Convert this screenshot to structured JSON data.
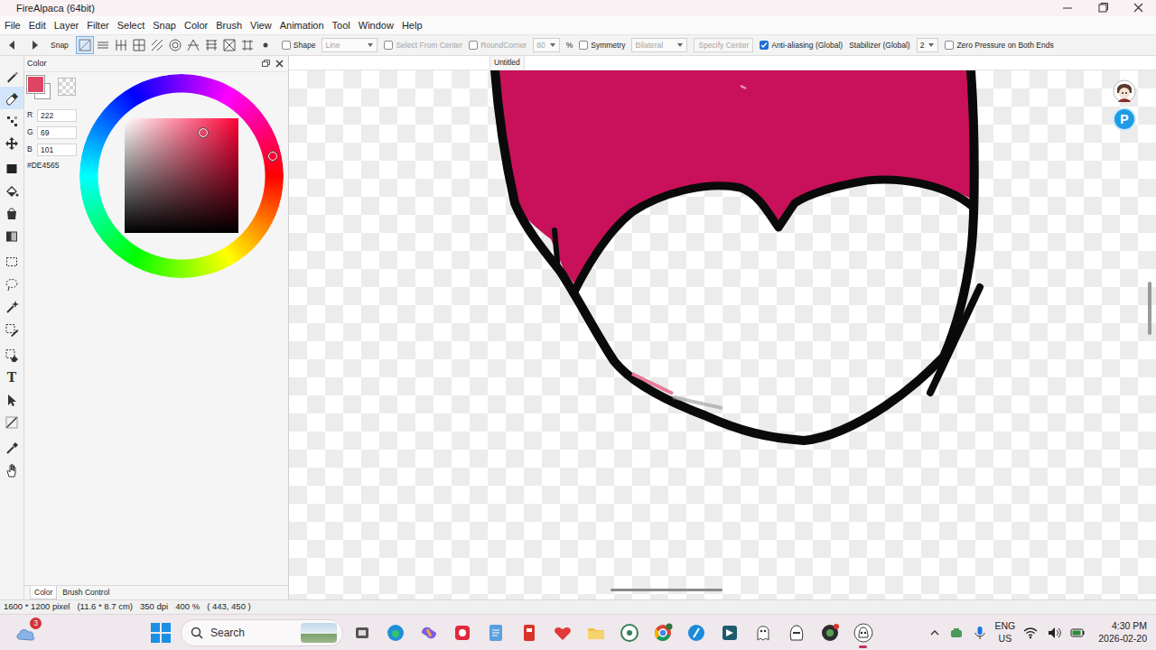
{
  "window": {
    "title": "FireAlpaca (64bit)"
  },
  "menu": [
    "File",
    "Edit",
    "Layer",
    "Filter",
    "Select",
    "Snap",
    "Color",
    "Brush",
    "View",
    "Animation",
    "Tool",
    "Window",
    "Help"
  ],
  "toolbar": {
    "snap_label": "Snap",
    "snap_modes": [
      {
        "selected": true
      },
      {
        "selected": false
      },
      {
        "selected": false
      },
      {
        "selected": false
      },
      {
        "selected": false
      },
      {
        "selected": false
      },
      {
        "selected": false
      },
      {
        "selected": false
      },
      {
        "selected": false
      },
      {
        "selected": false
      },
      {
        "selected": false
      }
    ],
    "controls": [
      {
        "kind": "checkbox",
        "label": "Shape",
        "checked": false,
        "disabled": false
      },
      {
        "kind": "select",
        "value": "Line",
        "disabled": true
      },
      {
        "kind": "checkbox",
        "label": "Select From Center",
        "checked": false,
        "disabled": true
      },
      {
        "kind": "checkbox",
        "label": "RoundCorner",
        "checked": false,
        "disabled": true
      },
      {
        "kind": "select",
        "value": "80",
        "disabled": true
      },
      {
        "kind": "text",
        "label": "%",
        "disabled": false
      },
      {
        "kind": "checkbox",
        "label": "Symmetry",
        "checked": false,
        "disabled": false
      },
      {
        "kind": "select",
        "value": "Bilateral",
        "disabled": true
      },
      {
        "kind": "button",
        "label": "Specify Center",
        "disabled": true
      },
      {
        "kind": "checkbox",
        "label": "Anti-aliasing (Global)",
        "checked": true,
        "disabled": false
      },
      {
        "kind": "text",
        "label": "Stabilizer (Global)",
        "disabled": false
      },
      {
        "kind": "select",
        "value": "2",
        "disabled": false
      },
      {
        "kind": "checkbox",
        "label": "Zero Pressure on Both Ends",
        "checked": false,
        "disabled": false
      }
    ]
  },
  "tools": [
    {
      "selected": false
    },
    {
      "selected": true
    },
    {
      "selected": false
    },
    {
      "selected": false
    },
    {
      "selected": false
    },
    {
      "selected": false
    },
    {
      "selected": false
    },
    {
      "selected": false
    },
    {
      "selected": false
    },
    {
      "selected": false
    },
    {
      "selected": false
    },
    {
      "selected": false
    },
    {
      "selected": false
    },
    {
      "selected": false,
      "glyph": "T"
    },
    {
      "selected": false
    },
    {
      "selected": false
    },
    {
      "selected": false
    },
    {
      "selected": false
    }
  ],
  "color_panel": {
    "title": "Color",
    "color": "#DE4565",
    "channels": [
      {
        "label": "R",
        "value": "222"
      },
      {
        "label": "G",
        "value": "69"
      },
      {
        "label": "B",
        "value": "101"
      }
    ],
    "hex": "#DE4565",
    "tabs": [
      {
        "label": "Color",
        "selected": true
      },
      {
        "label": "Brush Control",
        "selected": false
      }
    ]
  },
  "canvas": {
    "tab": "Untitled",
    "pixiv_button": "P",
    "scroll": {
      "horizontal": {
        "level": 0.375,
        "size": 0.13
      },
      "vertical": {
        "level": 0.4,
        "size": 0.1
      }
    }
  },
  "status_bar": {
    "size": "1600 * 1200 pixel",
    "physical": "(11.6 * 8.7 cm)",
    "dpi": "350 dpi",
    "zoom": "400 %",
    "cursor": "( 443, 450 )"
  },
  "taskbar": {
    "weather_badge": "3",
    "search": "Search",
    "apps": [
      {
        "active": false
      },
      {
        "active": false
      },
      {
        "active": false
      },
      {
        "active": false
      },
      {
        "active": false
      },
      {
        "active": false
      },
      {
        "active": false
      },
      {
        "active": false
      },
      {
        "active": false
      },
      {
        "active": false
      },
      {
        "active": false
      },
      {
        "active": false
      },
      {
        "active": false
      },
      {
        "active": false
      },
      {
        "active": false
      },
      {
        "active": true
      }
    ],
    "tray": {
      "lang": "ENG",
      "region": "US",
      "time": "4:30 PM",
      "date": "2026-02-20"
    }
  }
}
